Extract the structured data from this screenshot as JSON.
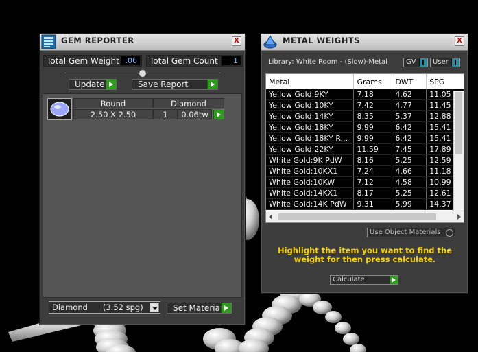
{
  "gem_reporter": {
    "title": "GEM REPORTER",
    "close_label": "X",
    "total_weight_label": "Total Gem Weight",
    "total_weight_value": ".06",
    "total_count_label": "Total Gem Count",
    "total_count_value": "1",
    "update_label": "Update",
    "save_report_label": "Save Report",
    "row": {
      "shape": "Round",
      "material": "Diamond",
      "size": "2.50 X 2.50",
      "count": "1",
      "weight": "0.06tw"
    },
    "material_select_value": "Diamond      (3.52 spg)",
    "set_material_label": "Set Material"
  },
  "metal_weights": {
    "title": "METAL WEIGHTS",
    "close_label": "X",
    "library": "Library: White Room - (Slow)-Metal",
    "gv_label": "GV",
    "user_label": "User",
    "columns": [
      "Metal",
      "Grams",
      "DWT",
      "SPG"
    ],
    "rows": [
      [
        "Yellow Gold:9KY",
        "7.18",
        "4.62",
        "11.05"
      ],
      [
        "Yellow Gold:10KY",
        "7.42",
        "4.77",
        "11.45"
      ],
      [
        "Yellow Gold:14KY",
        "8.35",
        "5.37",
        "12.88"
      ],
      [
        "Yellow Gold:18KY",
        "9.99",
        "6.42",
        "15.41"
      ],
      [
        "Yellow Gold:18KY R...",
        "9.99",
        "6.42",
        "15.41"
      ],
      [
        "Yellow Gold:22KY",
        "11.59",
        "7.45",
        "17.89"
      ],
      [
        "White Gold:9K PdW",
        "8.16",
        "5.25",
        "12.59"
      ],
      [
        "White Gold:10KX1",
        "7.24",
        "4.66",
        "11.18"
      ],
      [
        "White Gold:10KW",
        "7.12",
        "4.58",
        "10.99"
      ],
      [
        "White Gold:14KX1",
        "8.17",
        "5.25",
        "12.61"
      ],
      [
        "White Gold:14K PdW",
        "9.31",
        "5.99",
        "14.37"
      ]
    ],
    "use_object_materials_label": "Use Object Materials",
    "hint": "Highlight the item you want to find the weight for then press calculate.",
    "calculate_label": "Calculate"
  }
}
